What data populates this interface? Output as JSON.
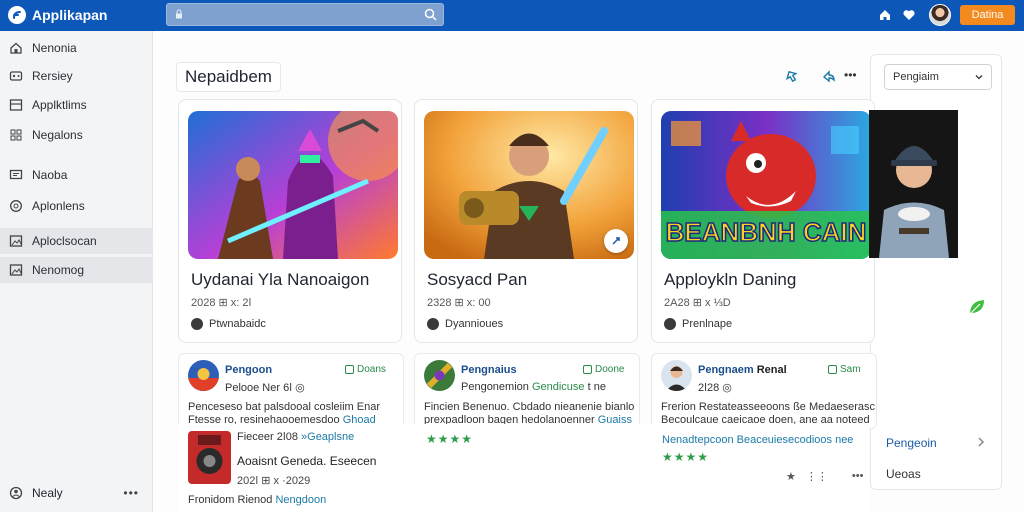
{
  "header": {
    "brand": "Applikapan",
    "search_placeholder": "",
    "cta_label": "Datina",
    "accent": "#0d57b8",
    "cta_color": "#f28a1e",
    "icons": [
      "home-icon",
      "heart-icon"
    ]
  },
  "sidebar": {
    "items": [
      {
        "label": "Nenonia",
        "icon": "home-icon"
      },
      {
        "label": "Rersiey",
        "icon": "gamepad-icon"
      },
      {
        "label": "Applktlims",
        "icon": "list-icon"
      },
      {
        "label": "Negalons",
        "icon": "grid-icon"
      },
      {
        "label": "Naoba",
        "icon": "chat-icon"
      },
      {
        "label": "Aplonlens",
        "icon": "clock-icon"
      },
      {
        "label": "Aploclsocan",
        "icon": "image-icon"
      },
      {
        "label": "Nenomog",
        "icon": "image-icon"
      }
    ],
    "footer": {
      "label": "Nealy",
      "more": "•••"
    }
  },
  "main": {
    "page_title": "Nepaidbem",
    "toolbar_icons": [
      "share-icon",
      "refresh-icon",
      "more-icon"
    ],
    "toolbar_more": "•••",
    "select_value": "Pengiaim",
    "cards": [
      {
        "title": "Uydanai Yla Nanoaigon",
        "meta": "2028 ⊞ x: 2ǀ",
        "publisher": "Ptwnabaidc"
      },
      {
        "title": "Sosyacd Pan",
        "meta": "2328 ⊞ x: 00",
        "publisher": "Dyannioues"
      },
      {
        "title": "Apploykln Daning",
        "meta": "2A28 ⊞ x ⅓D",
        "publisher": "Prenlnape",
        "art_text": "BEANBNH CAIN"
      }
    ],
    "reviews": [
      {
        "name": "Pengoon",
        "tag": "Doans",
        "meta": "Pelooe Ner 6ǀ ◎",
        "lines": [
          {
            "text": "Penceseso bat palsdooal cosleiim Enar",
            "highlight": ""
          },
          {
            "text": "Ftesse ro, resinehaooemesdoo ",
            "highlight": "Ghoad"
          }
        ]
      },
      {
        "name": "Pengnaius",
        "tag": "Doone",
        "meta_before": "Pengonemion ",
        "meta_highlight": "Gendicuse",
        "meta_after": " t ne",
        "lines": [
          {
            "text": "Fincien Benenuo. Cbdado nieanenie bianlo",
            "highlight": ""
          },
          {
            "text": "prexpadloon bagen hedolanoenner ",
            "highlight": "Guaiss"
          }
        ],
        "stars": "★★★★"
      },
      {
        "name": "Pengnaem",
        "name_extra": "Renal",
        "tag": "Sam",
        "meta": "2ǀ28 ◎",
        "lines": [
          {
            "text": "Frerion Restateasseeoons ße Medaeserasc",
            "highlight": ""
          },
          {
            "text": "Becoulcaue caeicaoe doen, ane aa noteed",
            "highlight": ""
          },
          {
            "text": "",
            "highlight": "Nenadtepcoon Beaceuiesecodioos nee"
          }
        ],
        "stars": "★★★★"
      }
    ],
    "overlay": {
      "line1_before": "Fieceer 2ǀ08 ",
      "line1_highlight": "»Geaplsne",
      "line2": "Aoaisnt Geneda. Eseecen",
      "line3": "202ǀ ⊞ x ·2029",
      "line4_before": "Fronidom Rienod ",
      "line4_highlight": "Nengdoon",
      "actions": [
        "★",
        "⋮⋮",
        "•••"
      ]
    }
  },
  "right_panel": {
    "link": "Pengeoin",
    "text": "Ueoas"
  }
}
